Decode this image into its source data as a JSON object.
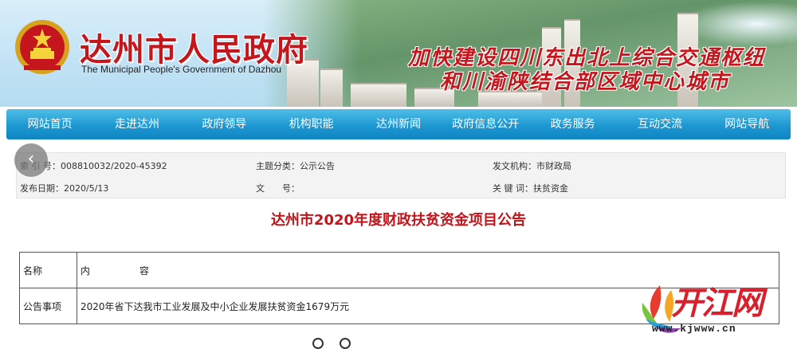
{
  "header": {
    "title": "达州市人民政府",
    "subtitle": "The Municipal People's Government of Dazhou",
    "slogan_line1": "加快建设四川东出北上综合交通枢纽",
    "slogan_line2": "和川渝陕结合部区域中心城市",
    "emblem": "national-emblem"
  },
  "nav": {
    "items": [
      "网站首页",
      "走进达州",
      "政府领导",
      "机构职能",
      "达州新闻",
      "政府信息公开",
      "政务服务",
      "互动交流",
      "网站导航"
    ]
  },
  "meta": {
    "index_label": "索 引 号：",
    "index_value": "008810032/2020-45392",
    "topic_label": "主题分类：",
    "topic_value": "公示公告",
    "org_label": "发文机构：",
    "org_value": "市财政局",
    "date_label": "发布日期：",
    "date_value": "2020/5/13",
    "docno_label": "文　　号：",
    "docno_value": "",
    "keywords_label": "关 键 词：",
    "keywords_value": "扶贫资金"
  },
  "back_icon": "chevron-left-icon",
  "article": {
    "title": "达州市2020年度财政扶贫资金项目公告",
    "table": {
      "header_name": "名称",
      "header_content_1": "内",
      "header_content_2": "容",
      "row1_name": "公告事项",
      "row1_content": "2020年省下达我市工业发展及中小企业发展扶贫资金1679万元"
    }
  },
  "watermark": {
    "text": "开江网",
    "url": "www.kjwww.cn"
  },
  "colors": {
    "title_red": "#c4161c",
    "nav_blue": "#1d97d1",
    "article_red": "#c0151b"
  }
}
